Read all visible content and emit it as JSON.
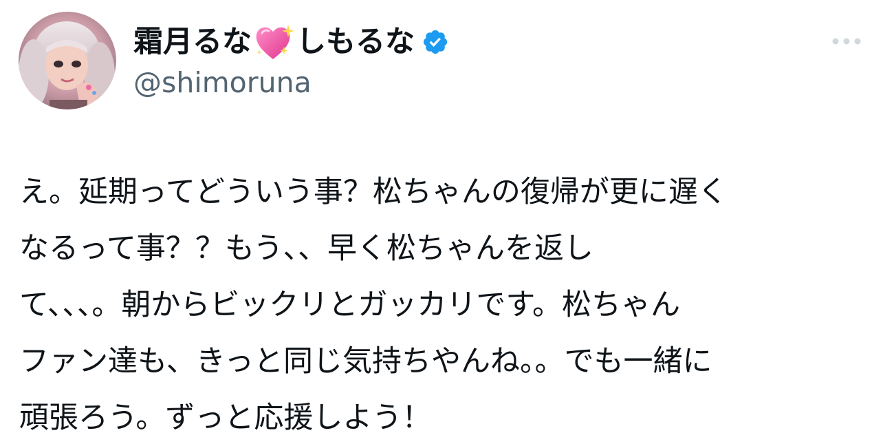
{
  "author": {
    "name_part1": "霜月るな",
    "name_part2": "しもるな",
    "handle": "@shimoruna",
    "verified": true,
    "name_emoji_icon": "sparkling-heart-icon",
    "verified_icon": "verified-badge-icon",
    "verified_color": "#1d9bf0",
    "avatar_icon": "profile-photo"
  },
  "more_menu_icon": "more-dots-icon",
  "tweet_lines": [
    "え。延期ってどういう事？松ちゃんの復帰が更に遅く",
    "なるって事？？もう、、早く松ちゃんを返し",
    "て、、、。朝からビックリとガッカリです。松ちゃん",
    "ファン達も、きっと同じ気持ちやんね。。でも一緒に",
    "頑張ろう。ずっと応援しよう！"
  ]
}
